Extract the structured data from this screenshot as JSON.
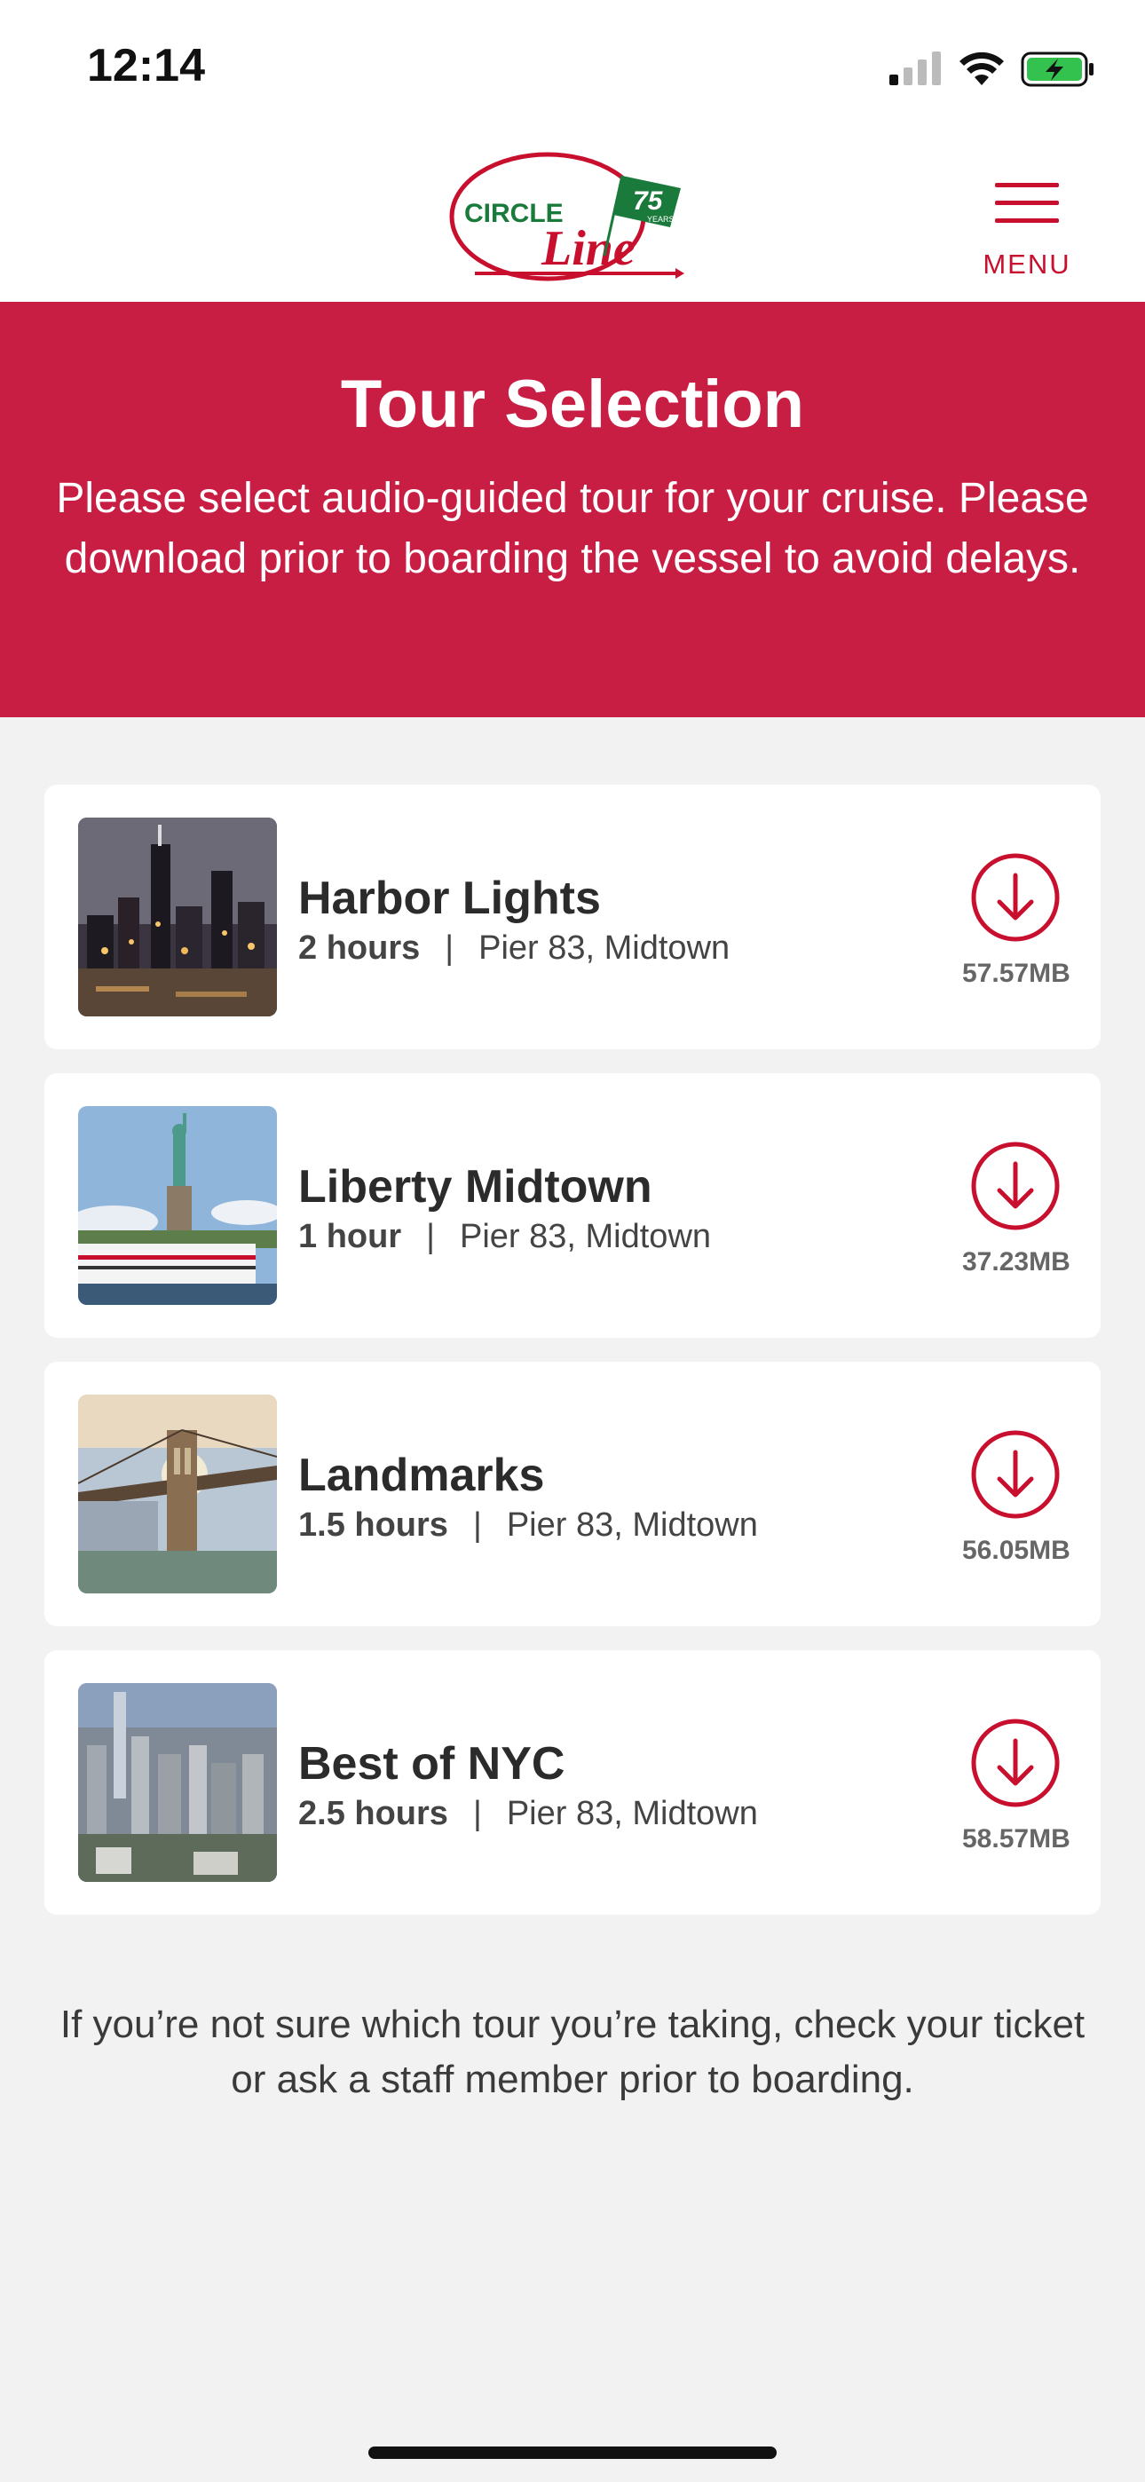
{
  "status_bar": {
    "time": "12:14"
  },
  "header": {
    "logo_text_top": "CIRCLE",
    "logo_text_bottom": "Line",
    "logo_flag": "75",
    "logo_flag_sub": "YEARS",
    "menu_label": "MENU"
  },
  "banner": {
    "title": "Tour Selection",
    "subtitle": "Please select audio-guided tour for your cruise. Please download prior to boarding the vessel to avoid delays."
  },
  "tours": [
    {
      "name": "Harbor Lights",
      "duration": "2 hours",
      "location": "Pier 83, Midtown",
      "size": "57.57MB",
      "icon": "download-icon"
    },
    {
      "name": "Liberty Midtown",
      "duration": "1 hour",
      "location": "Pier 83, Midtown",
      "size": "37.23MB",
      "icon": "download-icon"
    },
    {
      "name": "Landmarks",
      "duration": "1.5 hours",
      "location": "Pier 83, Midtown",
      "size": "56.05MB",
      "icon": "download-icon"
    },
    {
      "name": "Best of NYC",
      "duration": "2.5 hours",
      "location": "Pier 83, Midtown",
      "size": "58.57MB",
      "icon": "download-icon"
    }
  ],
  "separator": "|",
  "footer": {
    "note": "If you’re not sure which tour you’re taking, check your ticket or ask a staff member prior to boarding."
  },
  "colors": {
    "brand_red": "#c91e44",
    "accent_red": "#c8102e",
    "logo_green": "#1a7a3c",
    "background": "#f2f2f2"
  }
}
